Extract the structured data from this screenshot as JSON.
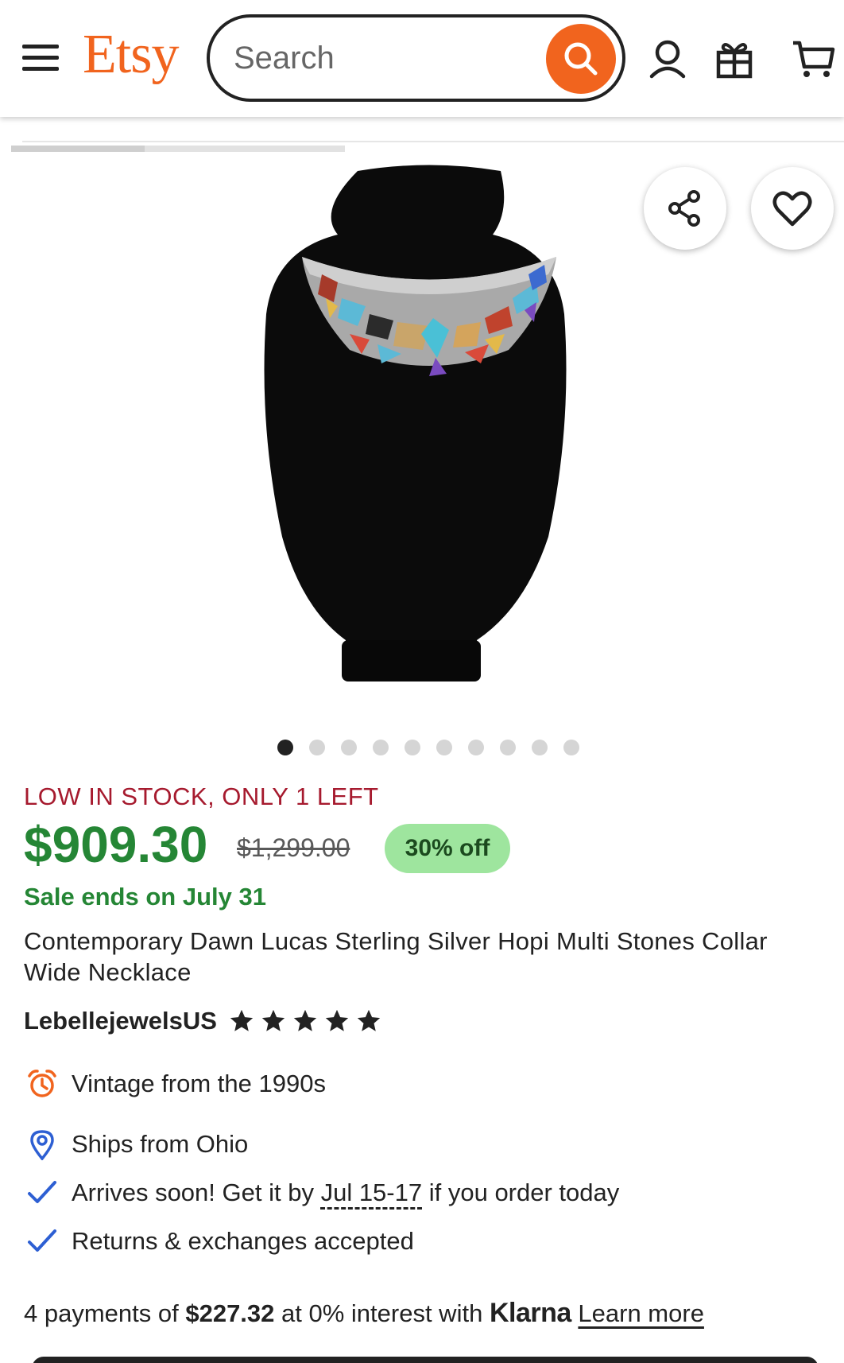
{
  "header": {
    "logo": "Etsy",
    "search_placeholder": "Search"
  },
  "gallery": {
    "image_index": 1,
    "image_count": 10,
    "progress_fraction": 0.4
  },
  "product": {
    "stock_notice": "LOW IN STOCK, ONLY 1 LEFT",
    "price": "$909.30",
    "original_price": "$1,299.00",
    "discount": "30% off",
    "sale_ends": "Sale ends on July 31",
    "title": "Contemporary Dawn Lucas Sterling Silver Hopi Multi Stones Collar Wide Necklace",
    "shop_name": "LebellejewelsUS",
    "rating": 5
  },
  "details": {
    "vintage": "Vintage from the 1990s",
    "ships_from": "Ships from Ohio",
    "arrives_prefix": "Arrives soon! Get it by",
    "arrives_date": "Jul 15-17",
    "arrives_suffix": "if you order today",
    "returns": "Returns & exchanges accepted"
  },
  "payment": {
    "prefix": "4 payments of",
    "amount": "$227.32",
    "middle": "at 0% interest with",
    "provider": "Klarna",
    "link": "Learn more"
  },
  "colors": {
    "brand": "#F1641E",
    "price_green": "#258635",
    "stock_red": "#A61A2E",
    "discount_bg": "#9EE59E",
    "check_blue": "#2D5FD3"
  }
}
